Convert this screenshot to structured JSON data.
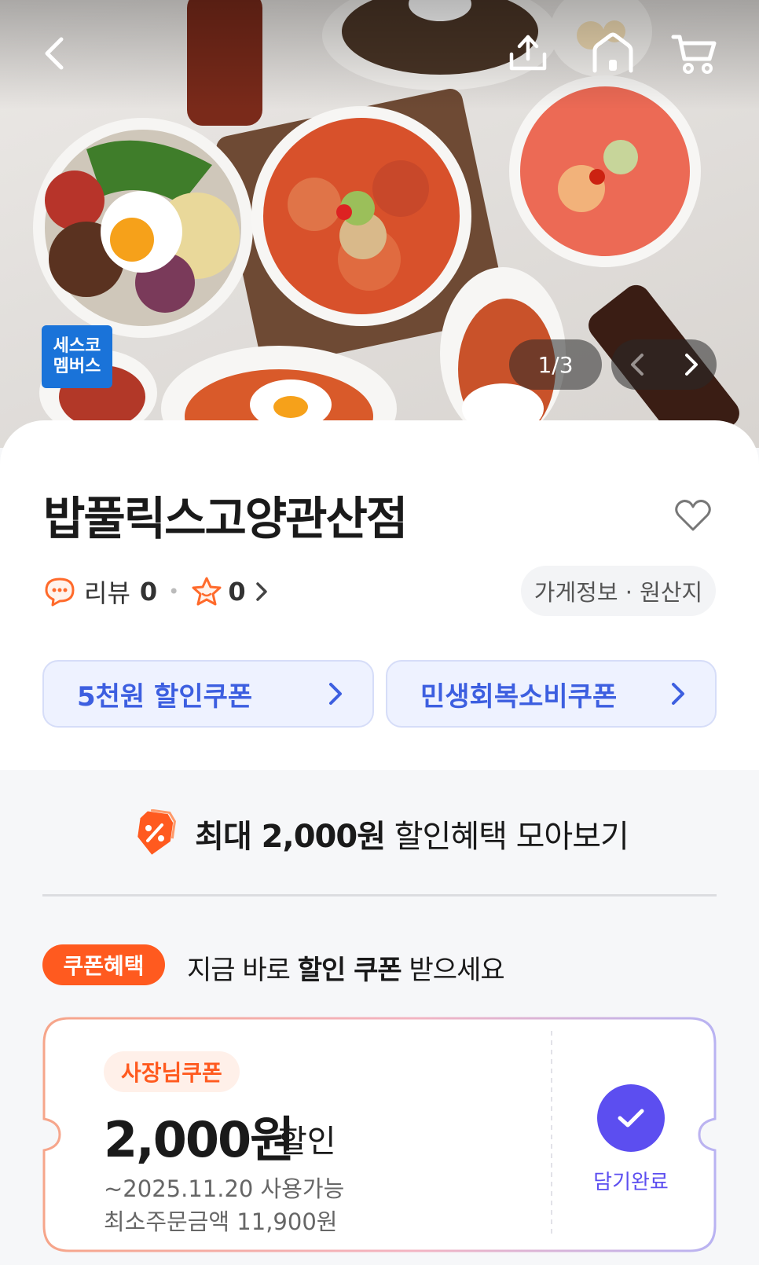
{
  "header": {
    "badge_line1": "세스코",
    "badge_line2": "멤버스",
    "page_indicator": "1/3"
  },
  "store": {
    "name": "밥풀릭스고양관산점",
    "review_label": "리뷰",
    "review_count": "0",
    "rating_count": "0",
    "info_label": "가게정보 · 원산지"
  },
  "coupons_quick": [
    {
      "label": "5천원 할인쿠폰"
    },
    {
      "label": "민생회복소비쿠폰"
    }
  ],
  "benefit": {
    "title_bold": "최대 2,000원",
    "title_rest": " 할인혜택 모아보기",
    "tag": "쿠폰혜택",
    "tagline_pre": "지금 바로 ",
    "tagline_bold": "할인 쿠폰",
    "tagline_post": " 받으세요"
  },
  "ticket": {
    "type": "사장님쿠폰",
    "amount": "2,000원",
    "suffix": "할인",
    "valid_until": "~2025.11.20 사용가능",
    "min_order": "최소주문금액 11,900원",
    "saved_label": "담기완료"
  },
  "colors": {
    "accent_blue": "#3d5fe0",
    "accent_orange": "#ff5a1f",
    "accent_purple": "#5c4ef0"
  }
}
